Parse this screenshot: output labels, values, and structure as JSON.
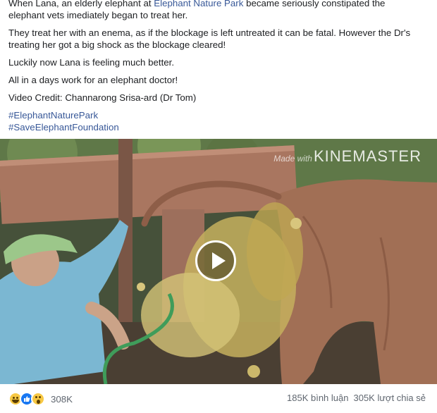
{
  "post": {
    "line1_before": "When Lana, an elderly elephant at ",
    "park_link": "Elephant Nature Park",
    "line1_after": " became seriously constipated the",
    "line2": "elephant vets imediately began to treat her.",
    "para2_line1": "They treat her with an enema, as if the blockage is left untreated it can be fatal. However the Dr's",
    "para2_line2": "treating her got a big shock as the blockage cleared!",
    "para3": "Luckily now Lana is feeling much better.",
    "para4": "All in a days work for an elephant doctor!",
    "credit": "Video Credit:  Channarong Srisa-ard (Dr Tom)",
    "hashtags": [
      "#ElephantNaturePark",
      "#SaveElephantFoundation"
    ]
  },
  "video": {
    "watermark_small": "Made with",
    "watermark_brand": "KINEMASTER"
  },
  "footer": {
    "reaction_icons": [
      "haha-icon",
      "like-icon",
      "wow-icon"
    ],
    "reaction_count": "308K",
    "comments": "185K bình luận",
    "shares": "305K lượt chia sẻ"
  },
  "colors": {
    "link": "#385898",
    "like": "#1877f2",
    "emoji": "#f7c844",
    "meta_text": "#606770"
  }
}
